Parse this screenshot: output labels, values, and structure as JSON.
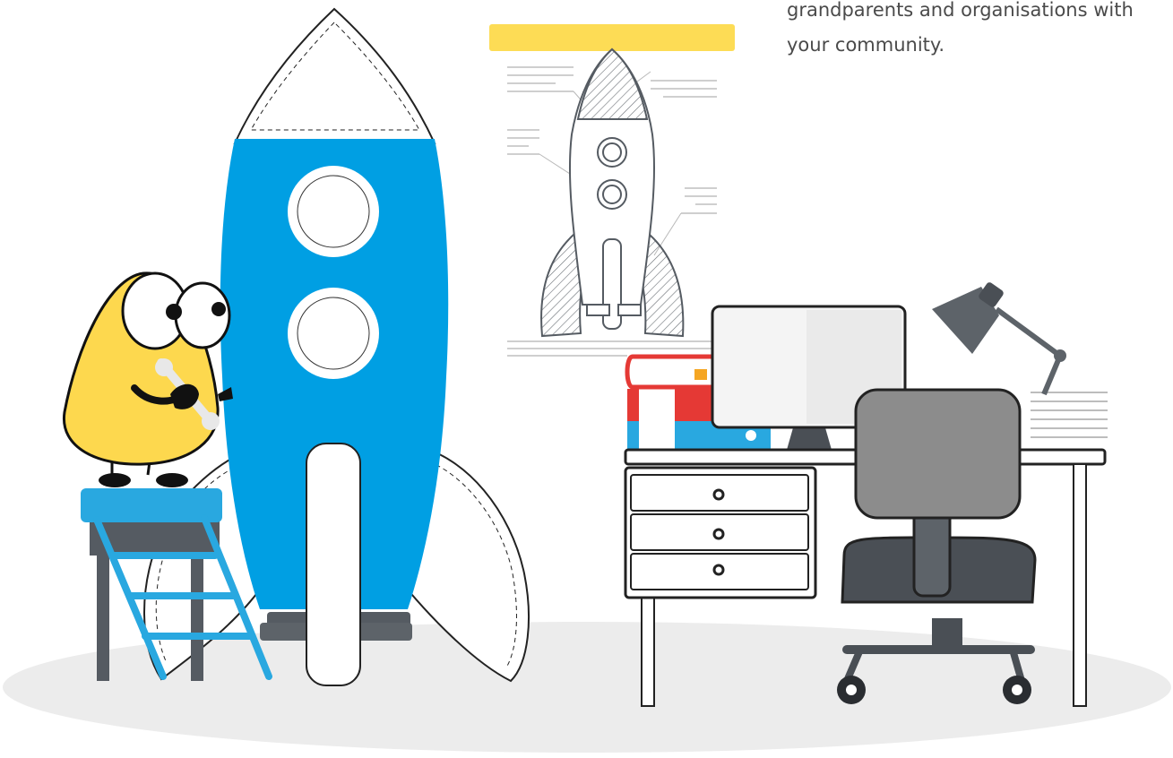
{
  "intro_text": {
    "line_1": "grandparents and organisations with",
    "line_2": "your community."
  },
  "colors": {
    "rocket_blue": "#009fe3",
    "mascot_yellow": "#fdd84e",
    "heading_bar_yellow": "#fddc55",
    "book_red": "#e53935",
    "ladder_blue": "#29a8e0",
    "floor_grey": "#ececec",
    "text_grey": "#4a4a4a"
  },
  "illustration": {
    "rocket": "rocket-illustration",
    "mascot": "yellow-mascot-holding-wrench",
    "blueprint": "rocket-blueprint-poster",
    "desk": "office-desk-with-computer",
    "chair": "office-chair-icon",
    "lamp": "desk-lamp-icon"
  }
}
